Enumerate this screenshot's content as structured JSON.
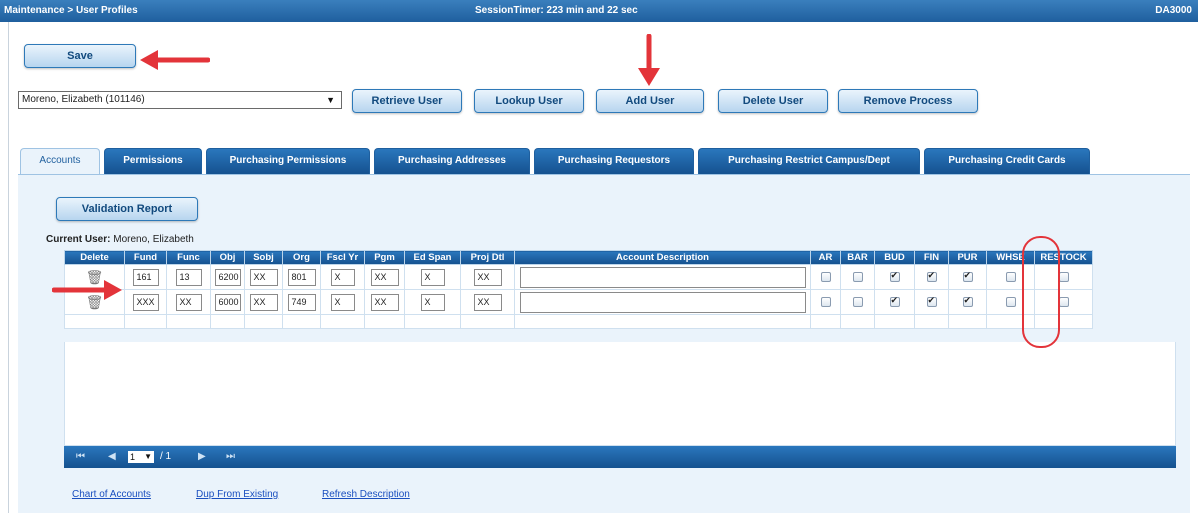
{
  "topbar": {
    "breadcrumb": "Maintenance > User Profiles",
    "session_timer": "SessionTimer: 223 min and 22 sec",
    "code": "DA3000"
  },
  "toolbar": {
    "save": "Save"
  },
  "user_select": {
    "value": "Moreno, Elizabeth (101146)",
    "caret": "▼"
  },
  "actions": {
    "retrieve": "Retrieve User",
    "lookup": "Lookup User",
    "add": "Add User",
    "delete": "Delete User",
    "remove": "Remove Process"
  },
  "tabs": [
    "Accounts",
    "Permissions",
    "Purchasing Permissions",
    "Purchasing Addresses",
    "Purchasing Requestors",
    "Purchasing Restrict Campus/Dept",
    "Purchasing Credit Cards"
  ],
  "validation_button": "Validation Report",
  "current_user": {
    "label": "Current User:",
    "name": "Moreno, Elizabeth"
  },
  "columns": [
    "Delete",
    "Fund",
    "Func",
    "Obj",
    "Sobj",
    "Org",
    "Fscl Yr",
    "Pgm",
    "Ed Span",
    "Proj Dtl",
    "Account Description",
    "AR",
    "BAR",
    "BUD",
    "FIN",
    "PUR",
    "WHSE",
    "RESTOCK"
  ],
  "rows": [
    {
      "fund": "161",
      "func": "13",
      "obj": "6200",
      "sobj": "XX",
      "org": "801",
      "fscl_yr": "X",
      "pgm": "XX",
      "ed_span": "X",
      "proj_dtl": "XX",
      "desc": "",
      "ar": false,
      "bar": false,
      "bud": true,
      "fin": true,
      "pur": true,
      "whse": false,
      "restock": false
    },
    {
      "fund": "XXX",
      "func": "XX",
      "obj": "6000",
      "sobj": "XX",
      "org": "749",
      "fscl_yr": "X",
      "pgm": "XX",
      "ed_span": "X",
      "proj_dtl": "XX",
      "desc": "",
      "ar": false,
      "bar": false,
      "bud": true,
      "fin": true,
      "pur": true,
      "whse": false,
      "restock": false
    }
  ],
  "pager": {
    "first": "⏮",
    "prev": "◀",
    "page": "1",
    "caret": "▼",
    "of": "/ 1",
    "next": "▶",
    "last": "⏭"
  },
  "links": {
    "chart": "Chart of Accounts",
    "dup": "Dup From Existing",
    "refresh": "Refresh Description"
  },
  "icons": {
    "trash": "trash-icon"
  },
  "colors": {
    "header_blue": "#1f5f9e",
    "arrow_red": "#e3343a",
    "link_blue": "#1a4fbf"
  }
}
